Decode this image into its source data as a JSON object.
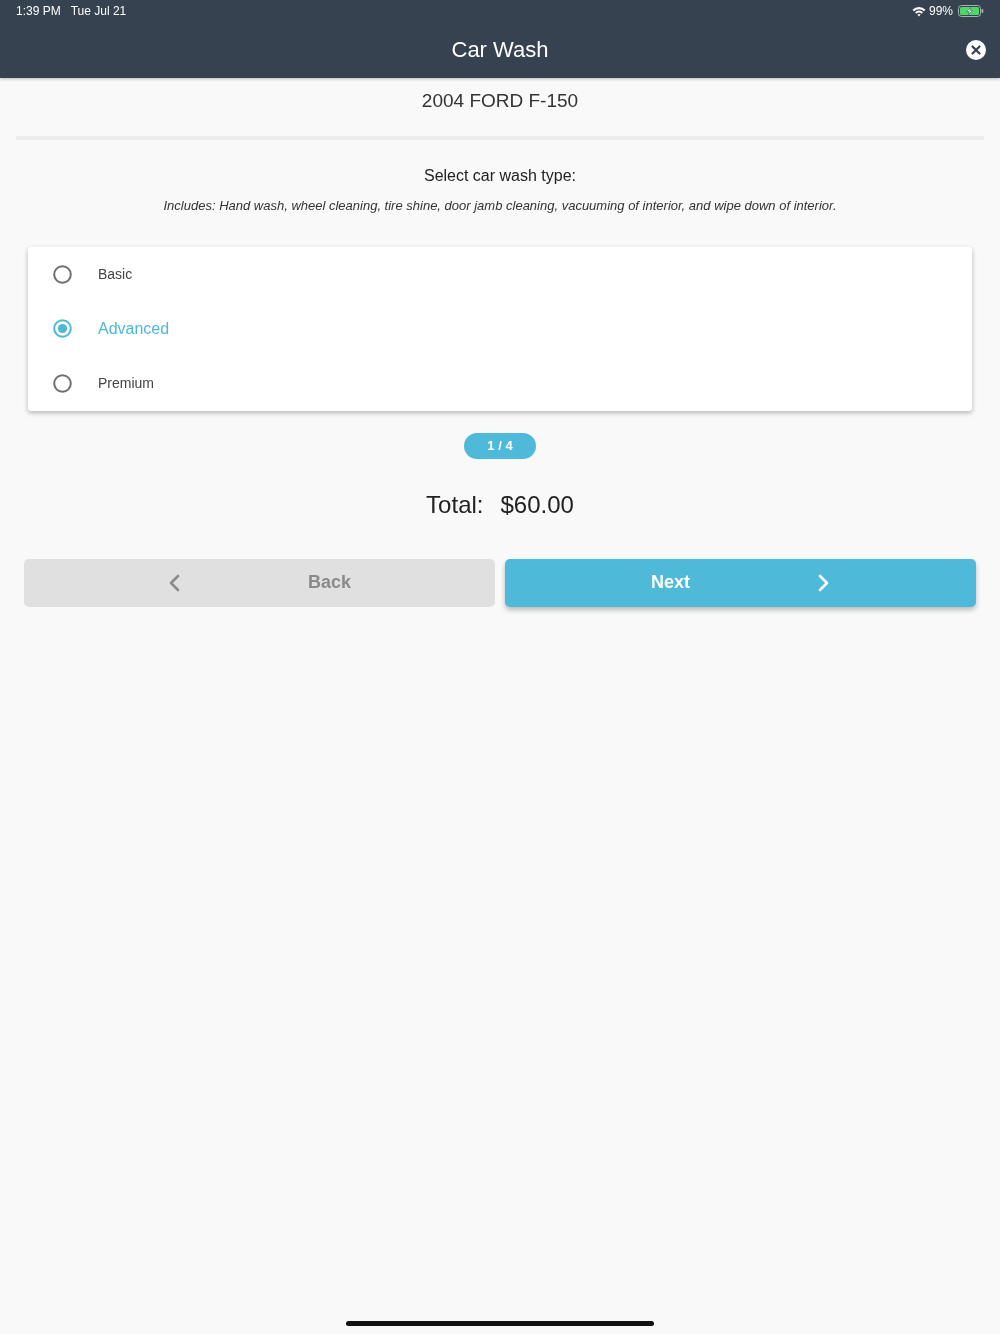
{
  "status_bar": {
    "time": "1:39 PM",
    "date": "Tue Jul 21",
    "battery_text": "99%"
  },
  "header": {
    "title": "Car Wash"
  },
  "vehicle": "2004 FORD F-150",
  "section": {
    "title": "Select car wash type:",
    "description": "Includes: Hand wash, wheel cleaning, tire shine, door jamb cleaning, vacuuming of interior, and wipe down of interior."
  },
  "options": [
    {
      "label": "Basic",
      "selected": false
    },
    {
      "label": "Advanced",
      "selected": true
    },
    {
      "label": "Premium",
      "selected": false
    }
  ],
  "step": "1 / 4",
  "total": {
    "label": "Total:",
    "amount": "$60.00"
  },
  "buttons": [
    {
      "kind": "back",
      "label": "Back",
      "disabled": true
    },
    {
      "kind": "next",
      "label": "Next",
      "disabled": false
    }
  ]
}
